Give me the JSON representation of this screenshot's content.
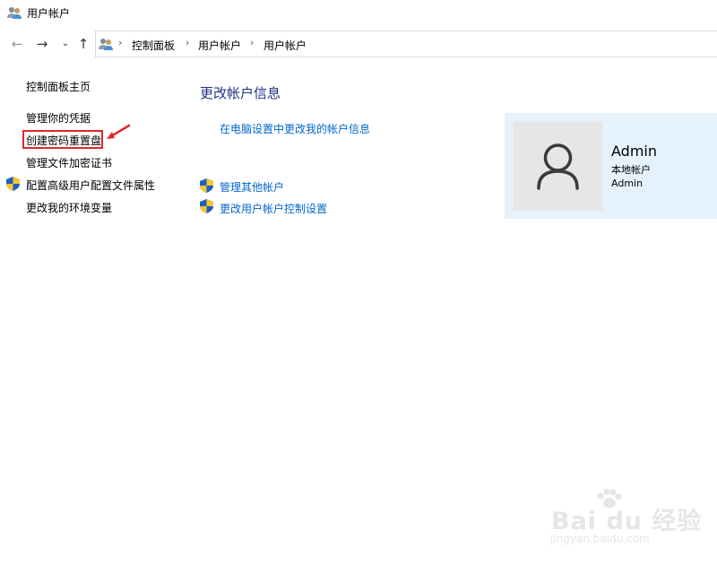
{
  "window": {
    "title": "用户帐户",
    "icon": "users-icon"
  },
  "nav": {
    "back_icon": "arrow-left-icon",
    "forward_icon": "arrow-right-icon",
    "recent_icon": "chevron-down-icon",
    "up_icon": "arrow-up-icon",
    "breadcrumb": [
      "控制面板",
      "用户帐户",
      "用户帐户"
    ]
  },
  "sidebar": {
    "items": [
      {
        "label": "控制面板主页",
        "shield": false
      },
      {
        "label": "管理你的凭据",
        "shield": false
      },
      {
        "label": "创建密码重置盘",
        "shield": false,
        "highlighted": true
      },
      {
        "label": "管理文件加密证书",
        "shield": false
      },
      {
        "label": "配置高级用户配置文件属性",
        "shield": true
      },
      {
        "label": "更改我的环境变量",
        "shield": false
      }
    ]
  },
  "main": {
    "heading": "更改帐户信息",
    "links": [
      {
        "label": "在电脑设置中更改我的帐户信息",
        "shield": false
      },
      {
        "label": "管理其他帐户",
        "shield": true
      },
      {
        "label": "更改用户帐户控制设置",
        "shield": true
      }
    ]
  },
  "account": {
    "name": "Admin",
    "type": "本地帐户",
    "group": "Admin",
    "avatar_icon": "user-silhouette-icon"
  },
  "colors": {
    "link": "#0066cc",
    "heading": "#1e3287",
    "card_bg": "#e5f1fb",
    "highlight": "#e0262b"
  },
  "watermark": {
    "brand": "Bai du 经验",
    "url": "jingyan.baidu.com"
  }
}
